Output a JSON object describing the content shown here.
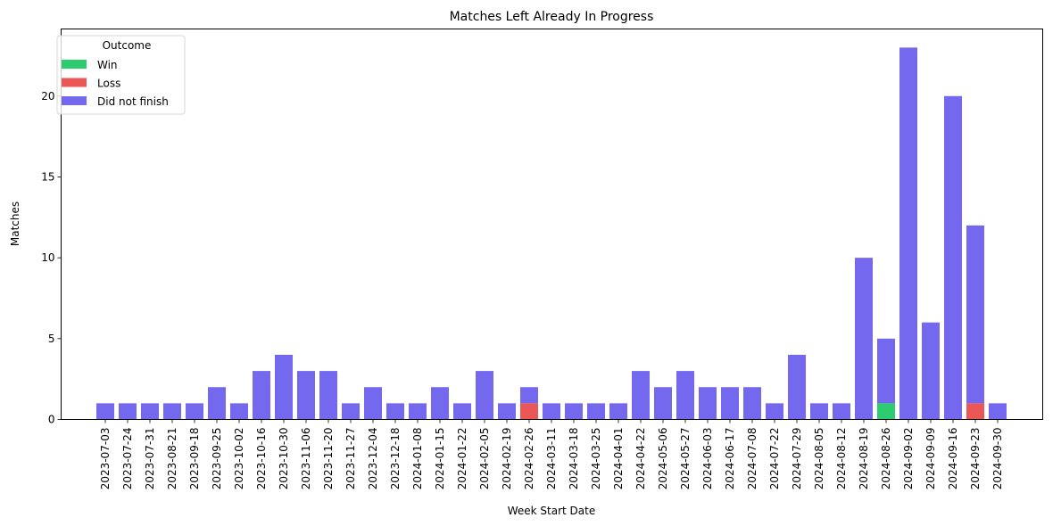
{
  "chart_data": {
    "type": "bar",
    "stacked": true,
    "title": "Matches Left Already In Progress",
    "xlabel": "Week Start Date",
    "ylabel": "Matches",
    "ylim": [
      0,
      24.15
    ],
    "yticks": [
      0,
      5,
      10,
      15,
      20
    ],
    "grid": false,
    "legend": {
      "title": "Outcome",
      "placement": "top-left"
    },
    "categories": [
      "2023-07-03",
      "2023-07-24",
      "2023-07-31",
      "2023-08-21",
      "2023-09-18",
      "2023-09-25",
      "2023-10-02",
      "2023-10-16",
      "2023-10-30",
      "2023-11-06",
      "2023-11-20",
      "2023-11-27",
      "2023-12-04",
      "2023-12-18",
      "2024-01-08",
      "2024-01-15",
      "2024-01-22",
      "2024-02-05",
      "2024-02-19",
      "2024-02-26",
      "2024-03-11",
      "2024-03-18",
      "2024-03-25",
      "2024-04-01",
      "2024-04-22",
      "2024-05-06",
      "2024-05-27",
      "2024-06-03",
      "2024-06-17",
      "2024-07-08",
      "2024-07-22",
      "2024-07-29",
      "2024-08-05",
      "2024-08-12",
      "2024-08-19",
      "2024-08-26",
      "2024-09-02",
      "2024-09-09",
      "2024-09-16",
      "2024-09-23",
      "2024-09-30"
    ],
    "series": [
      {
        "name": "Win",
        "color": "#2ecc71",
        "values": [
          0,
          0,
          0,
          0,
          0,
          0,
          0,
          0,
          0,
          0,
          0,
          0,
          0,
          0,
          0,
          0,
          0,
          0,
          0,
          0,
          0,
          0,
          0,
          0,
          0,
          0,
          0,
          0,
          0,
          0,
          0,
          0,
          0,
          0,
          0,
          1,
          0,
          0,
          0,
          0,
          0
        ]
      },
      {
        "name": "Loss",
        "color": "#eb5757",
        "values": [
          0,
          0,
          0,
          0,
          0,
          0,
          0,
          0,
          0,
          0,
          0,
          0,
          0,
          0,
          0,
          0,
          0,
          0,
          0,
          1,
          0,
          0,
          0,
          0,
          0,
          0,
          0,
          0,
          0,
          0,
          0,
          0,
          0,
          0,
          0,
          0,
          0,
          0,
          0,
          1,
          0
        ]
      },
      {
        "name": "Did not finish",
        "color": "#7468ee",
        "values": [
          1,
          1,
          1,
          1,
          1,
          2,
          1,
          3,
          4,
          3,
          3,
          1,
          2,
          1,
          1,
          2,
          1,
          3,
          1,
          1,
          1,
          1,
          1,
          1,
          3,
          2,
          3,
          2,
          2,
          2,
          1,
          4,
          1,
          1,
          10,
          4,
          23,
          6,
          20,
          11,
          1
        ]
      }
    ]
  }
}
